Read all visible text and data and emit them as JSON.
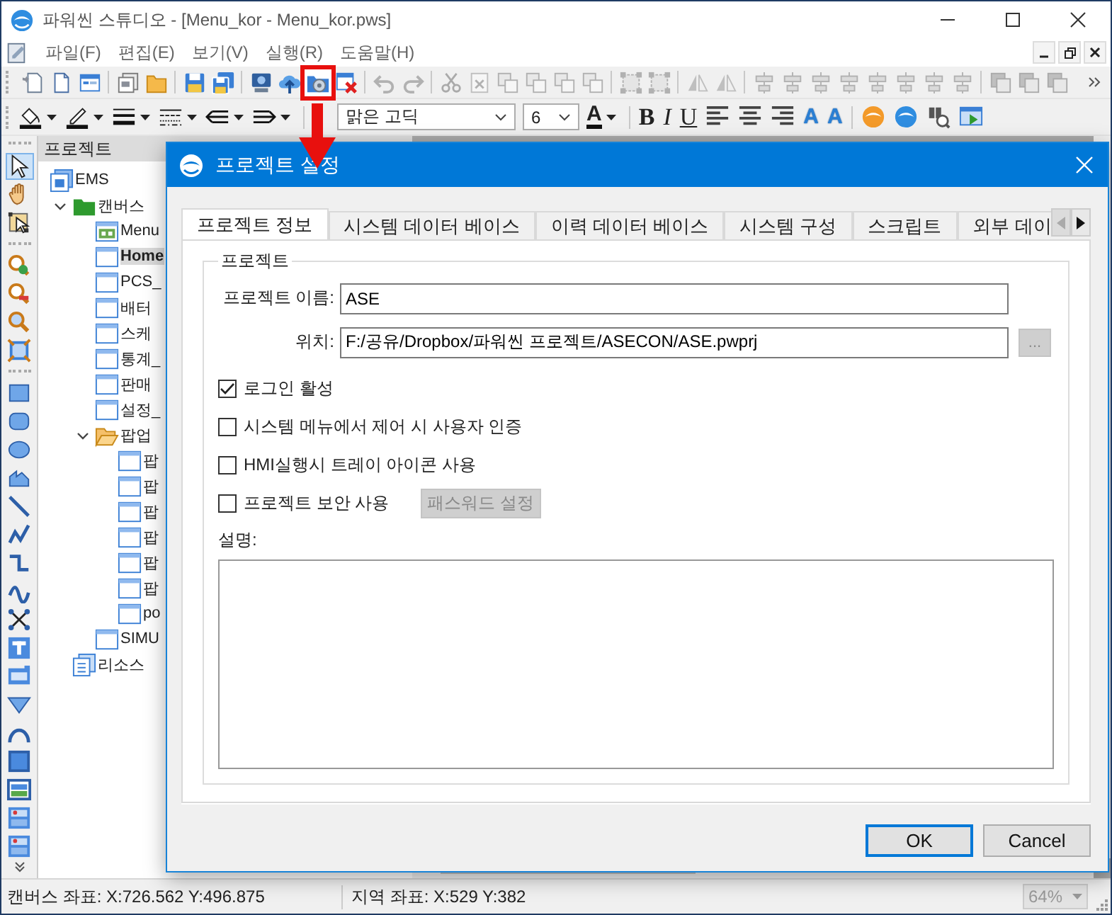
{
  "window": {
    "title": "파워씬 스튜디오 - [Menu_kor - Menu_kor.pws]"
  },
  "menu": [
    "파일(F)",
    "편집(E)",
    "보기(V)",
    "실행(R)",
    "도움말(H)"
  ],
  "toolbar": [
    [
      {
        "kind": "page-star",
        "disabled": false,
        "highlighted": false
      },
      {
        "kind": "page",
        "disabled": false,
        "highlighted": false
      },
      {
        "kind": "window",
        "disabled": false,
        "highlighted": false
      }
    ],
    [
      {
        "kind": "pages",
        "disabled": false,
        "highlighted": false
      },
      {
        "kind": "folder",
        "disabled": false,
        "highlighted": false
      }
    ],
    [
      {
        "kind": "floppy",
        "disabled": false,
        "highlighted": false
      },
      {
        "kind": "floppies",
        "disabled": false,
        "highlighted": false
      }
    ],
    [
      {
        "kind": "drive",
        "disabled": false,
        "highlighted": false
      },
      {
        "kind": "upload",
        "disabled": false,
        "highlighted": false
      },
      {
        "kind": "gear-folder",
        "disabled": false,
        "highlighted": true
      },
      {
        "kind": "delete",
        "disabled": false,
        "highlighted": false
      }
    ],
    [
      {
        "kind": "undo",
        "disabled": true,
        "highlighted": false
      },
      {
        "kind": "redo",
        "disabled": true,
        "highlighted": false
      }
    ],
    [
      {
        "kind": "scissors",
        "disabled": true,
        "highlighted": false
      },
      {
        "kind": "close-doc",
        "disabled": true,
        "highlighted": false
      },
      {
        "kind": "copy",
        "disabled": true,
        "highlighted": false
      },
      {
        "kind": "copy",
        "disabled": true,
        "highlighted": false
      },
      {
        "kind": "copy",
        "disabled": true,
        "highlighted": false
      },
      {
        "kind": "copy",
        "disabled": true,
        "highlighted": false
      }
    ],
    [
      {
        "kind": "group",
        "disabled": true,
        "highlighted": false
      },
      {
        "kind": "group",
        "disabled": true,
        "highlighted": false
      }
    ],
    [
      {
        "kind": "flip",
        "disabled": true,
        "highlighted": false
      },
      {
        "kind": "flip",
        "disabled": true,
        "highlighted": false
      }
    ],
    [
      {
        "kind": "align",
        "disabled": true,
        "highlighted": false
      },
      {
        "kind": "align",
        "disabled": true,
        "highlighted": false
      },
      {
        "kind": "align",
        "disabled": true,
        "highlighted": false
      },
      {
        "kind": "align",
        "disabled": true,
        "highlighted": false
      },
      {
        "kind": "align",
        "disabled": true,
        "highlighted": false
      },
      {
        "kind": "align",
        "disabled": true,
        "highlighted": false
      },
      {
        "kind": "align",
        "disabled": true,
        "highlighted": false
      },
      {
        "kind": "align",
        "disabled": true,
        "highlighted": false
      }
    ],
    [
      {
        "kind": "order",
        "disabled": true,
        "highlighted": false
      },
      {
        "kind": "order",
        "disabled": true,
        "highlighted": false
      },
      {
        "kind": "order",
        "disabled": true,
        "highlighted": false
      }
    ]
  ],
  "format_bar": {
    "font": "맑은 고딕",
    "size": "6",
    "color_button": "A",
    "style_buttons": [
      "B",
      "I",
      "U"
    ],
    "font_size_buttons": [
      "A",
      "A"
    ]
  },
  "tools": [
    [
      {
        "kind": "pointer",
        "selected": true
      },
      {
        "kind": "hand",
        "selected": false
      },
      {
        "kind": "node",
        "selected": false
      }
    ],
    [
      {
        "kind": "zoom-in",
        "selected": false
      },
      {
        "kind": "zoom-out",
        "selected": false
      },
      {
        "kind": "zoom",
        "selected": false
      },
      {
        "kind": "zoom-fit",
        "selected": false
      }
    ],
    [
      {
        "kind": "rect",
        "selected": false
      },
      {
        "kind": "rounded-rect",
        "selected": false
      },
      {
        "kind": "ellipse",
        "selected": false
      },
      {
        "kind": "polygon",
        "selected": false
      },
      {
        "kind": "line",
        "selected": false
      },
      {
        "kind": "polyline",
        "selected": false
      },
      {
        "kind": "elbow",
        "selected": false
      },
      {
        "kind": "curve",
        "selected": false
      },
      {
        "kind": "nodes",
        "selected": false
      },
      {
        "kind": "text",
        "selected": false
      },
      {
        "kind": "display",
        "selected": false
      },
      {
        "kind": "triangle",
        "selected": false
      },
      {
        "kind": "arc",
        "selected": false
      },
      {
        "kind": "square",
        "selected": false
      },
      {
        "kind": "image",
        "selected": false
      },
      {
        "kind": "tile",
        "selected": false
      },
      {
        "kind": "tile",
        "selected": false
      }
    ]
  ],
  "project_panel": {
    "title": "프로젝트",
    "tree": [
      {
        "label": "EMS",
        "kind": "project",
        "selected": false,
        "children": [
          {
            "label": "캔버스",
            "kind": "folder",
            "expanded": true,
            "selected": false,
            "children": [
              {
                "label": "Menu",
                "kind": "menu-canvas",
                "selected": false
              },
              {
                "label": "Home",
                "kind": "canvas",
                "selected": true
              },
              {
                "label": "PCS_",
                "kind": "canvas",
                "selected": false
              },
              {
                "label": "배터",
                "kind": "canvas",
                "selected": false
              },
              {
                "label": "스케",
                "kind": "canvas",
                "selected": false
              },
              {
                "label": "통계_",
                "kind": "canvas",
                "selected": false
              },
              {
                "label": "판매",
                "kind": "canvas",
                "selected": false
              },
              {
                "label": "설정_",
                "kind": "canvas",
                "selected": false
              },
              {
                "label": "팝업",
                "kind": "open-folder",
                "expanded": true,
                "selected": false,
                "children": [
                  {
                    "label": "팝",
                    "kind": "canvas",
                    "selected": false
                  },
                  {
                    "label": "팝",
                    "kind": "canvas",
                    "selected": false
                  },
                  {
                    "label": "팝",
                    "kind": "canvas",
                    "selected": false
                  },
                  {
                    "label": "팝",
                    "kind": "canvas",
                    "selected": false
                  },
                  {
                    "label": "팝",
                    "kind": "canvas",
                    "selected": false
                  },
                  {
                    "label": "팝",
                    "kind": "canvas",
                    "selected": false
                  },
                  {
                    "label": "po",
                    "kind": "canvas",
                    "selected": false
                  }
                ]
              },
              {
                "label": "SIMU",
                "kind": "canvas",
                "selected": false
              }
            ]
          },
          {
            "label": "리소스",
            "kind": "resources",
            "selected": false
          }
        ]
      }
    ]
  },
  "dialog": {
    "title": "프로젝트 설정",
    "tabs": [
      {
        "label": "프로젝트 정보",
        "selected": true
      },
      {
        "label": "시스템 데이터 베이스",
        "selected": false
      },
      {
        "label": "이력 데이터 베이스",
        "selected": false
      },
      {
        "label": "시스템 구성",
        "selected": false
      },
      {
        "label": "스크립트",
        "selected": false
      },
      {
        "label": "외부 데이",
        "selected": false
      }
    ],
    "group_title": "프로젝트",
    "fields": [
      {
        "label": "프로젝트 이름:",
        "value": "ASE"
      },
      {
        "label": "위치:",
        "value": "F:/공유/Dropbox/파워씬 프로젝트/ASECON/ASE.pwprj",
        "browse_button": "...",
        "browse_disabled": true
      }
    ],
    "options": [
      {
        "label": "로그인 활성",
        "checked": true
      },
      {
        "label": "시스템 메뉴에서 제어 시 사용자 인증",
        "checked": false
      },
      {
        "label": "HMI실행시 트레이 아이콘 사용",
        "checked": false
      },
      {
        "label": "프로젝트 보안 사용",
        "checked": false,
        "button": "패스워드 설정",
        "button_disabled": true
      }
    ],
    "description_label": "설명:",
    "buttons": [
      {
        "label": "OK",
        "default": true
      },
      {
        "label": "Cancel",
        "default": false
      }
    ]
  },
  "status_bar": {
    "canvas_coords": "캔버스 좌표: X:726.562 Y:496.875",
    "local_coords": "지역 좌표: X:529 Y:382",
    "zoom": "64%",
    "zoom_disabled": true
  }
}
